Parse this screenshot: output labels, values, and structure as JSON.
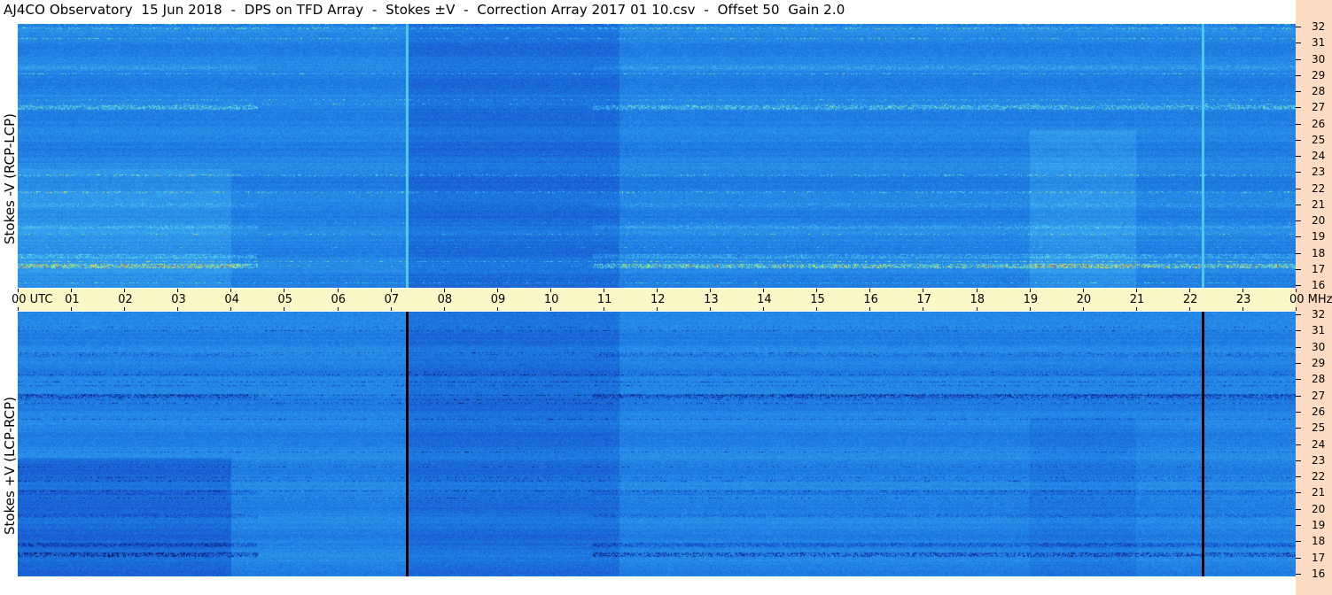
{
  "header": {
    "title": "AJ4CO Observatory  15 Jun 2018  -  DPS on TFD Array  -  Stokes ±V  -  Correction Array 2017 01 10.csv  -  Offset 50  Gain 2.0"
  },
  "colors": {
    "background_blue": "#1e7fe0",
    "dark_blue": "#1248b8",
    "light_blue": "#38a8f0",
    "time_band": "#fbf7c6",
    "right_strip": "#fbdcc3"
  },
  "chart_data": [
    {
      "type": "heatmap",
      "panel": "top",
      "ylabel": "Stokes -V (RCP-LCP)",
      "x_axis": {
        "unit": "UTC",
        "ticks": [
          "00 UTC",
          "01",
          "02",
          "03",
          "04",
          "05",
          "06",
          "07",
          "08",
          "09",
          "10",
          "11",
          "12",
          "13",
          "14",
          "15",
          "16",
          "17",
          "18",
          "19",
          "20",
          "21",
          "22",
          "23",
          "00 MHz"
        ],
        "xlim": [
          0,
          24
        ]
      },
      "y_axis": {
        "unit": "MHz",
        "ticks": [
          "16",
          "17",
          "18",
          "19",
          "20",
          "21",
          "22",
          "23",
          "24",
          "25",
          "26",
          "27",
          "28",
          "29",
          "30",
          "31",
          "32"
        ],
        "ylim": [
          16,
          32
        ]
      },
      "vertical_lines_utc": [
        7.3,
        22.25
      ],
      "vertical_line_style": "light"
    },
    {
      "type": "heatmap",
      "panel": "bottom",
      "ylabel": "Stokes +V (LCP-RCP)",
      "x_axis": {
        "unit": "UTC",
        "xlim": [
          0,
          24
        ]
      },
      "y_axis": {
        "unit": "MHz",
        "ticks": [
          "16",
          "17",
          "18",
          "19",
          "20",
          "21",
          "22",
          "23",
          "24",
          "25",
          "26",
          "27",
          "28",
          "29",
          "30",
          "31",
          "32"
        ],
        "ylim": [
          16,
          32
        ]
      },
      "vertical_lines_utc": [
        7.3,
        22.25
      ],
      "vertical_line_style": "dark"
    }
  ]
}
